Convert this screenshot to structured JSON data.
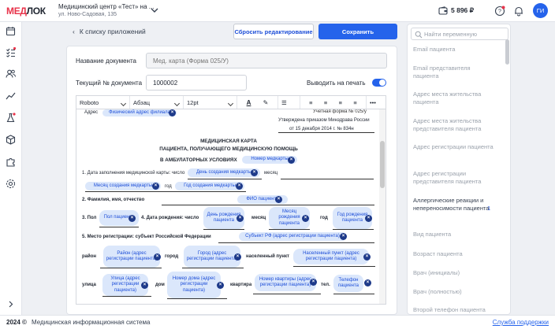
{
  "header": {
    "logo": {
      "left": "МЕД",
      "right": "ЛОК"
    },
    "org_name": "Медицинский центр «Тест» на ...",
    "org_address": "ул. Ново-Садовая, 135",
    "balance": "5 896 ₽",
    "avatar_initials": "ГИ"
  },
  "sidebar": {
    "icons": [
      "calendar-icon",
      "tasks-icon",
      "patients-icon",
      "analytics-icon",
      "lab-icon",
      "box-icon",
      "puzzle-icon",
      "settings-icon"
    ]
  },
  "toolbar_actions": {
    "back_label": "К списку приложений",
    "reset_label": "Сбросить редактирование",
    "save_label": "Сохранить"
  },
  "form": {
    "doc_name_label": "Название документа",
    "doc_name_placeholder": "Мед. карта (Форма 025/У)",
    "doc_number_label": "Текущий № документа",
    "doc_number_value": "1000002",
    "print_label": "Выводить на печать",
    "print_enabled": true
  },
  "editor_toolbar": {
    "font": "Roboto",
    "paragraph": "Абзац",
    "size": "12pt"
  },
  "document": {
    "address_label": "Адрес",
    "address_chip": "Физический адрес филиала",
    "form_line1": "Учетная форма № 025/у",
    "form_line2": "Утверждена приказом Минздрава России",
    "form_line3": "от 15 декабря 2014 г. № 834н",
    "title1": "МЕДИЦИНСКАЯ КАРТА",
    "title2": "ПАЦИЕНТА, ПОЛУЧАЮЩЕГО МЕДИЦИНСКУЮ ПОМОЩЬ",
    "title3": "В АМБУЛАТОРНЫХ УСЛОВИЯХ",
    "chip_card_number": "Номер медкарты",
    "s1_label": "1. Дата заполнения медицинской карты: число",
    "chip_day_created": "День создания медкарты",
    "s1_month": "месяц",
    "chip_month_created": "Месяц создания медкарты",
    "s1_year": "год",
    "chip_year_created": "Год создания медкарты",
    "s2_label": "2. Фамилия, имя, отчество",
    "chip_fio": "ФИО пациента",
    "s3_label": "3. Пол",
    "chip_gender": "Пол пациента",
    "s4_label": "4. Дата рождения: число",
    "chip_birth_day": "День рождения пациента",
    "s4_month": "месяц",
    "chip_birth_month": "Месяц рождения пациента",
    "s4_year": "год",
    "chip_birth_year": "Год рождения пациента",
    "s5_label": "5. Место регистрации: субъект Российской Федерации",
    "chip_subject": "Субъект РФ (адрес регистрации пациента)",
    "district_label": "район",
    "chip_district": "Район (адрес регистрации пациента)",
    "city_label": "город",
    "chip_city": "Город (адрес регистрации пациента)",
    "settlement_label": "населенный пункт",
    "chip_settlement": "Населенный пункт (адрес регистрации пациента)",
    "street_label": "улица",
    "chip_street": "Улица (адрес регистрации пациента)",
    "house_label": "дом",
    "chip_house": "Номер дома (адрес регистрации пациента)",
    "apt_label": "квартира",
    "chip_apt": "Номер квартиры (адрес регистрации пациента)",
    "phone_label": "тел.",
    "chip_phone": "Телефон пациента"
  },
  "variables": {
    "search_placeholder": "Найти переменную",
    "items": [
      "Email пациента",
      "Email представителя пациента",
      "Адрес места жительства пациента",
      "Адрес места жительства представителя пациента",
      "Адрес регистрации пациента",
      "Адрес регистрации представителя пациента",
      "Аллергические реакции и непереносимости пациента",
      "Вид пациента",
      "Возраст пациента",
      "Врач (инициалы)",
      "Врач (полностью)",
      "Второй телефон пациента"
    ],
    "allergy_count": "1"
  },
  "footer": {
    "year": "2024 ©",
    "system_name": "Медицинская информационная система",
    "support_link": "Служба поддержки"
  }
}
